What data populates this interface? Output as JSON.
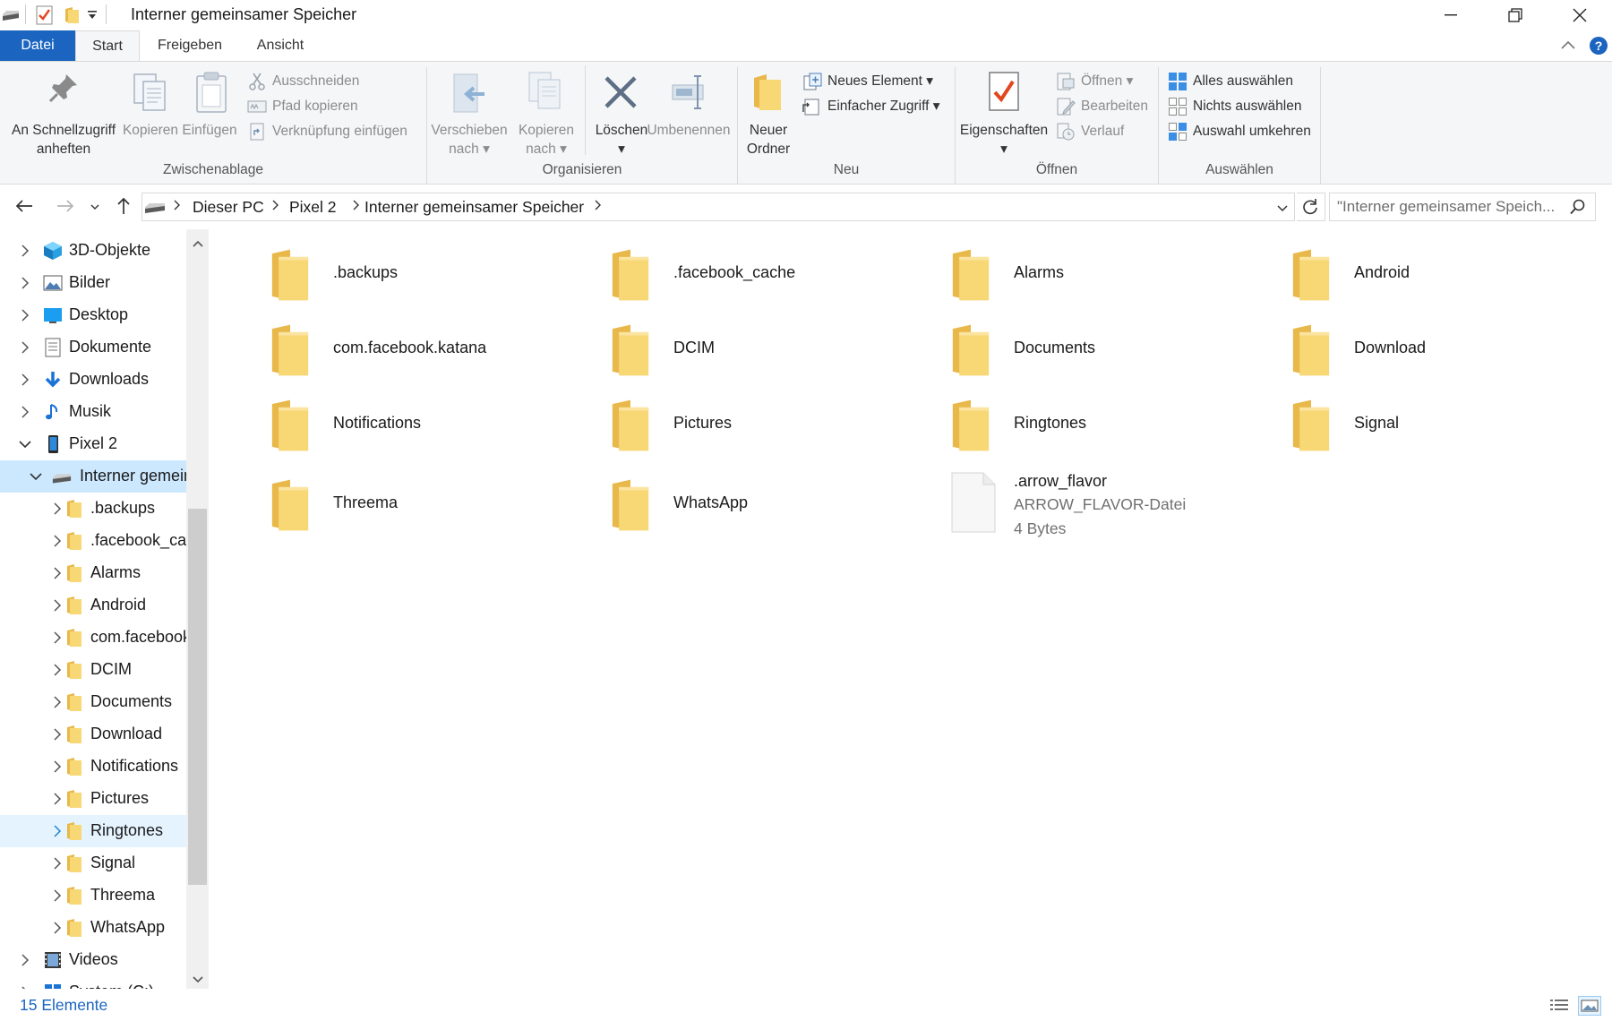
{
  "window": {
    "title": "Interner gemeinsamer Speicher"
  },
  "ribbon_tabs": {
    "file": "Datei",
    "start": "Start",
    "share": "Freigeben",
    "view": "Ansicht"
  },
  "ribbon": {
    "clipboard": {
      "label": "Zwischenablage",
      "pin_line1": "An Schnellzugriff",
      "pin_line2": "anheften",
      "copy": "Kopieren",
      "paste": "Einfügen",
      "cut": "Ausschneiden",
      "copy_path": "Pfad kopieren",
      "paste_shortcut": "Verknüpfung einfügen"
    },
    "organize": {
      "label": "Organisieren",
      "move_line1": "Verschieben",
      "move_line2": "nach",
      "copyto_line1": "Kopieren",
      "copyto_line2": "nach",
      "delete": "Löschen",
      "rename": "Umbenennen"
    },
    "new": {
      "label": "Neu",
      "new_folder_line1": "Neuer",
      "new_folder_line2": "Ordner",
      "new_item": "Neues Element",
      "easy_access": "Einfacher Zugriff"
    },
    "open": {
      "label": "Öffnen",
      "properties": "Eigenschaften",
      "open": "Öffnen",
      "edit": "Bearbeiten",
      "history": "Verlauf"
    },
    "select": {
      "label": "Auswählen",
      "select_all": "Alles auswählen",
      "select_none": "Nichts auswählen",
      "invert": "Auswahl umkehren"
    }
  },
  "address": {
    "crumbs": [
      "Dieser PC",
      "Pixel 2",
      "Interner gemeinsamer Speicher"
    ],
    "search_placeholder": "\"Interner gemeinsamer Speich..."
  },
  "nav": {
    "items": [
      {
        "label": "3D-Objekte",
        "icon": "3d-objects-icon"
      },
      {
        "label": "Bilder",
        "icon": "pictures-library-icon"
      },
      {
        "label": "Desktop",
        "icon": "desktop-icon"
      },
      {
        "label": "Dokumente",
        "icon": "documents-library-icon"
      },
      {
        "label": "Downloads",
        "icon": "downloads-icon"
      },
      {
        "label": "Musik",
        "icon": "music-icon"
      },
      {
        "label": "Pixel 2",
        "icon": "phone-icon"
      },
      {
        "label": "Interner gemeinsamer Speicher",
        "icon": "drive-icon"
      },
      {
        "label": ".backups",
        "icon": "folder-icon"
      },
      {
        "label": ".facebook_cache",
        "icon": "folder-icon"
      },
      {
        "label": "Alarms",
        "icon": "folder-icon"
      },
      {
        "label": "Android",
        "icon": "folder-icon"
      },
      {
        "label": "com.facebook.katana",
        "icon": "folder-icon"
      },
      {
        "label": "DCIM",
        "icon": "folder-icon"
      },
      {
        "label": "Documents",
        "icon": "folder-icon"
      },
      {
        "label": "Download",
        "icon": "folder-icon"
      },
      {
        "label": "Notifications",
        "icon": "folder-icon"
      },
      {
        "label": "Pictures",
        "icon": "folder-icon"
      },
      {
        "label": "Ringtones",
        "icon": "folder-icon"
      },
      {
        "label": "Signal",
        "icon": "folder-icon"
      },
      {
        "label": "Threema",
        "icon": "folder-icon"
      },
      {
        "label": "WhatsApp",
        "icon": "folder-icon"
      },
      {
        "label": "Videos",
        "icon": "videos-library-icon"
      },
      {
        "label": "System (C:)",
        "icon": "system-drive-icon"
      }
    ]
  },
  "content": {
    "folders": [
      ".backups",
      ".facebook_cache",
      "Alarms",
      "Android",
      "com.facebook.katana",
      "DCIM",
      "Documents",
      "Download",
      "Notifications",
      "Pictures",
      "Ringtones",
      "Signal",
      "Threema",
      "WhatsApp"
    ],
    "file": {
      "name": ".arrow_flavor",
      "type": "ARROW_FLAVOR-Datei",
      "size": "4 Bytes"
    }
  },
  "status": {
    "count": "15 Elemente"
  },
  "colors": {
    "accent": "#1b64c0",
    "folder": "#f8d775",
    "selection": "#cce8ff",
    "hover": "#e5f3ff"
  }
}
